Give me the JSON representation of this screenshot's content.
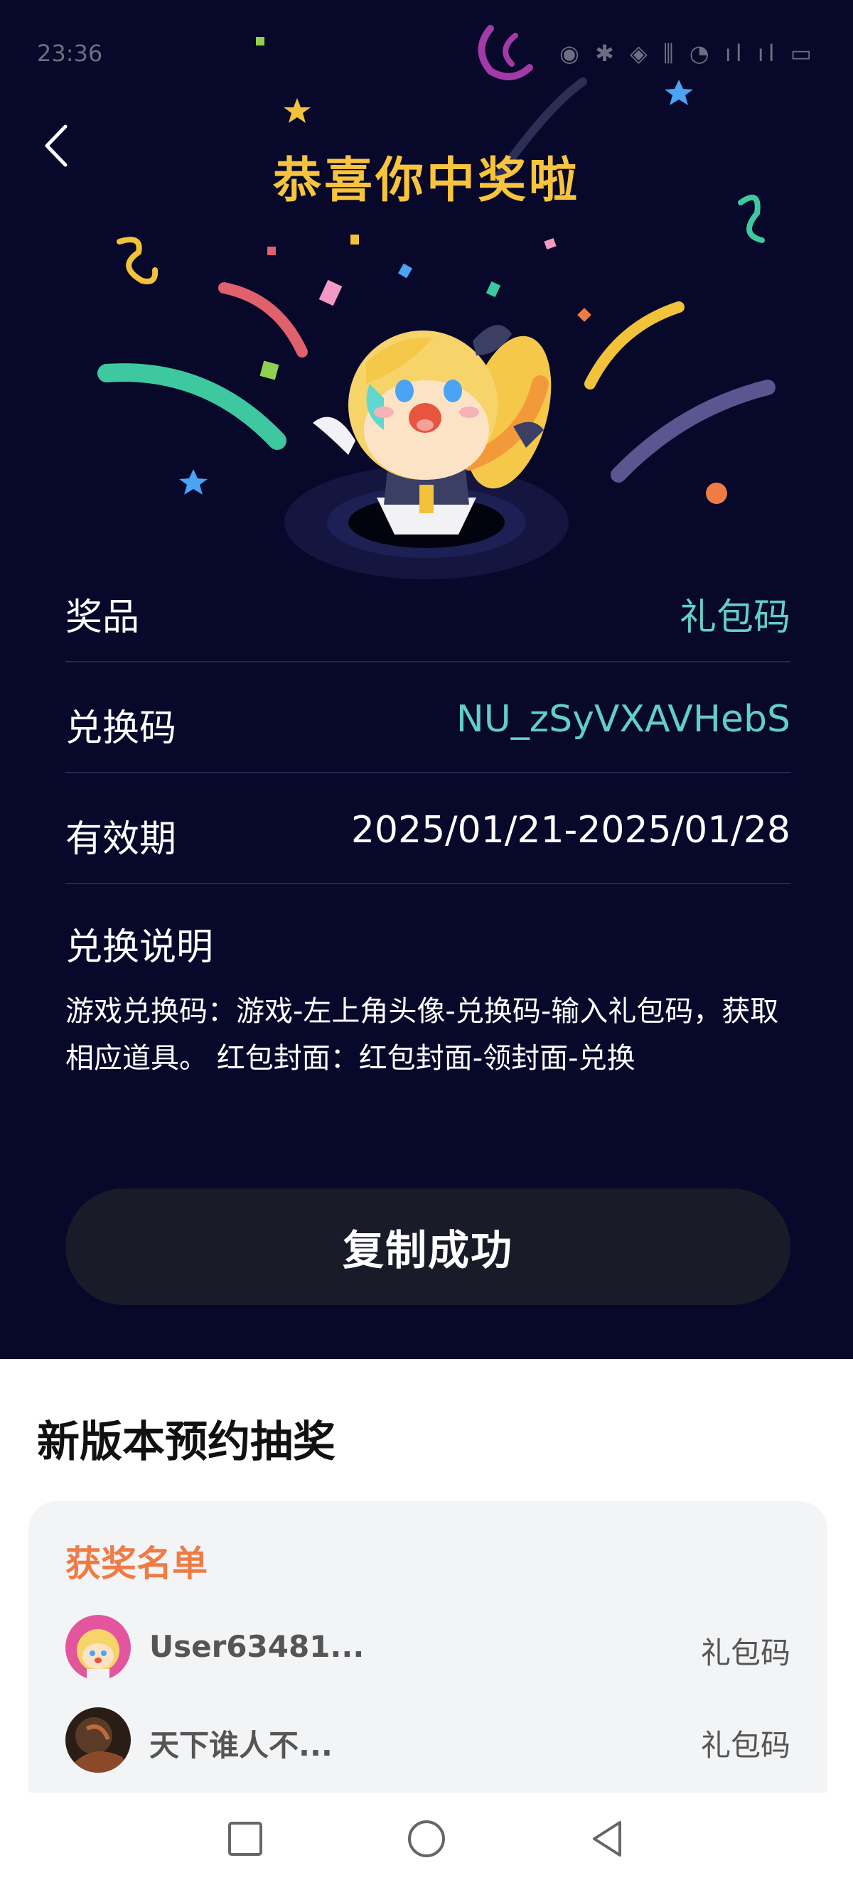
{
  "status_bar": {
    "time": "23:36",
    "icons": "◉ ✱ ◈ ⫼ ◔ ıl ıl ▭"
  },
  "header": {
    "back_icon": "chevron-left-icon",
    "title": "恭喜你中奖啦"
  },
  "prize_info": {
    "rows": [
      {
        "label": "奖品",
        "value": "礼包码",
        "color": "#62cfc6"
      },
      {
        "label": "兑换码",
        "value": "NU_zSyVXAVHebS",
        "color": "#62cfc6"
      },
      {
        "label": "有效期",
        "value": "2025/01/21-2025/01/28",
        "color": "#ffffff"
      }
    ]
  },
  "description": {
    "title": "兑换说明",
    "text": "游戏兑换码：游戏-左上角头像-兑换码-输入礼包码，获取相应道具。 红包封面：红包封面-领封面-兑换"
  },
  "copy_button": {
    "label": "复制成功"
  },
  "lottery": {
    "title": "新版本预约抽奖",
    "winners_title": "获奖名单",
    "winners": [
      {
        "name": "User63481...",
        "prize": "礼包码"
      },
      {
        "name": "天下谁人不...",
        "prize": "礼包码"
      }
    ]
  },
  "nav": {
    "recent_icon": "square-icon",
    "home_icon": "circle-icon",
    "back_icon": "triangle-back-icon"
  },
  "colors": {
    "hero_bg": "#07082a",
    "title": "#f8c43d",
    "accent": "#62cfc6",
    "winners_title": "#ef7b45"
  }
}
